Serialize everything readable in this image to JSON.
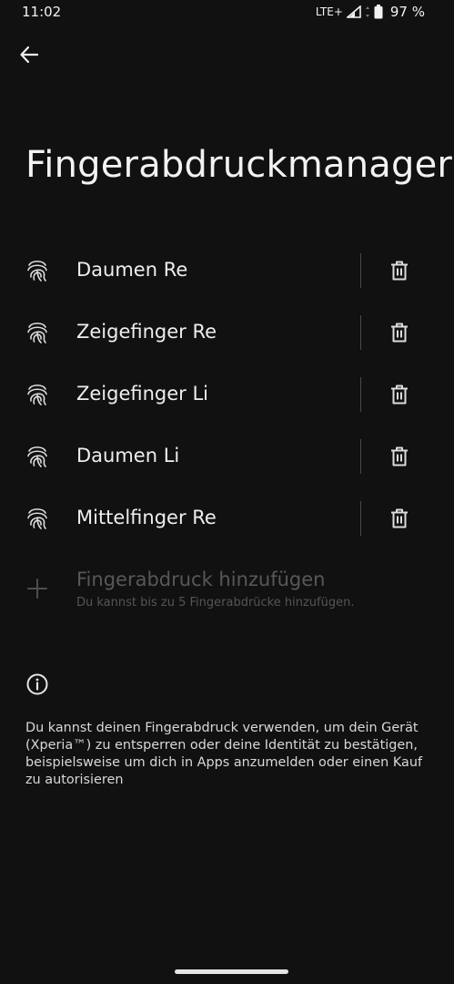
{
  "status_bar": {
    "time": "11:02",
    "network": "LTE+",
    "battery": "97 %"
  },
  "header": {
    "back_icon": "arrow-left-icon",
    "title": "Fingerabdruckmanager"
  },
  "fingerprints": [
    {
      "name": "Daumen Re",
      "icon": "fingerprint-icon",
      "action_icon": "trash-icon"
    },
    {
      "name": "Zeigefinger Re",
      "icon": "fingerprint-icon",
      "action_icon": "trash-icon"
    },
    {
      "name": "Zeigefinger Li",
      "icon": "fingerprint-icon",
      "action_icon": "trash-icon"
    },
    {
      "name": "Daumen Li",
      "icon": "fingerprint-icon",
      "action_icon": "trash-icon"
    },
    {
      "name": "Mittelfinger Re",
      "icon": "fingerprint-icon",
      "action_icon": "trash-icon"
    }
  ],
  "add_fingerprint": {
    "icon": "plus-icon",
    "title": "Fingerabdruck hinzufügen",
    "subtitle": "Du kannst bis zu 5 Fingerabdrücke hinzufügen."
  },
  "info": {
    "icon": "info-icon",
    "text": "Du kannst deinen Fingerabdruck verwenden, um dein Gerät (Xperia™) zu entsperren oder deine Identität zu bestätigen, beispielsweise um dich in Apps anzumelden oder einen Kauf zu autorisieren"
  },
  "colors": {
    "background": "#111112",
    "text_primary": "#eeeeee",
    "text_disabled": "#585858"
  }
}
